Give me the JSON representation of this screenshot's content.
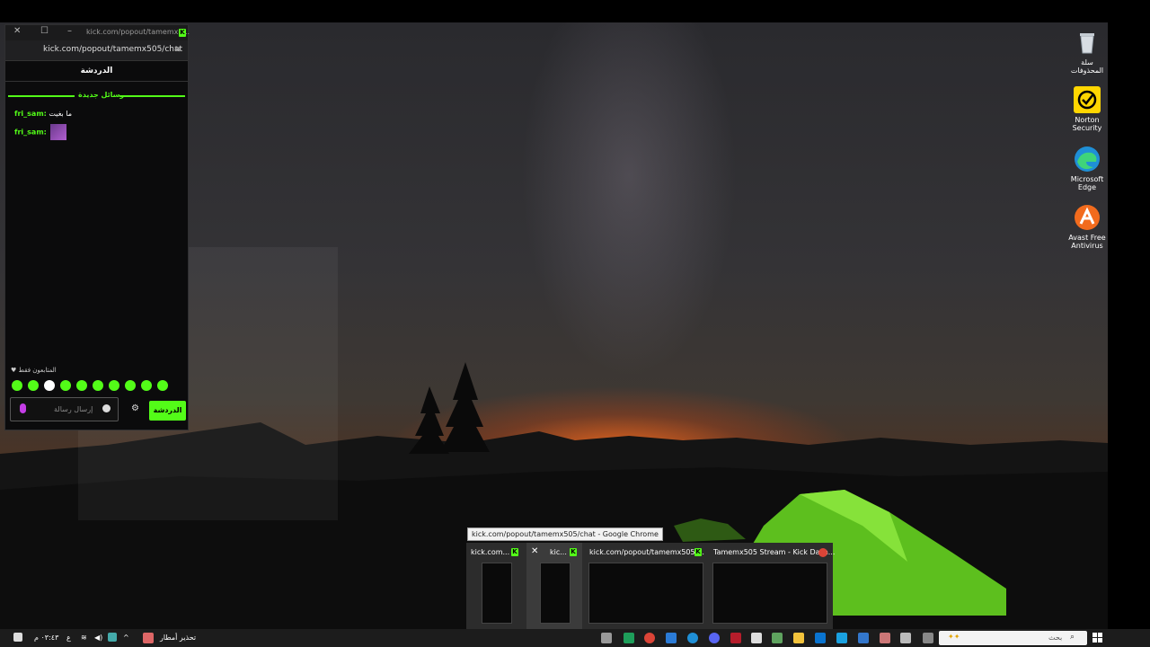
{
  "chat_window": {
    "title": "kick.com/popout/tamemx5...",
    "url": "kick.com/popout/tamemx505/chat",
    "header": "الدردشة",
    "new_messages_divider": "رسائل جديدة",
    "messages": [
      {
        "user": "fri_sam:",
        "text": "ما بغيت"
      },
      {
        "user": "fri_sam:",
        "text": ""
      }
    ],
    "followers_only": "المتابعون فقط",
    "input_placeholder": "إرسال رسالة",
    "chat_button": "الدردشة",
    "accent_color": "#53fc18"
  },
  "desktop_icons": [
    {
      "label": "سلة المحذوفات",
      "icon": "recycle-bin-icon"
    },
    {
      "label": "Norton Security",
      "icon": "norton-icon"
    },
    {
      "label": "Microsoft Edge",
      "icon": "edge-icon"
    },
    {
      "label": "Avast Free Antivirus",
      "icon": "avast-icon"
    }
  ],
  "taskbar_preview": {
    "tooltip": "kick.com/popout/tamemx505/chat - Google Chrome",
    "items": [
      {
        "title": "kick.com..."
      },
      {
        "title": "kic..."
      },
      {
        "title": "kick.com/popout/tamemx505/..."
      },
      {
        "title": "Tamemx505 Stream - Kick Dash..."
      }
    ]
  },
  "taskbar": {
    "weather_text": "تحذير أمطار",
    "language": "ع",
    "time": "٠٣:٤٣ م",
    "search_placeholder": "بحث"
  }
}
